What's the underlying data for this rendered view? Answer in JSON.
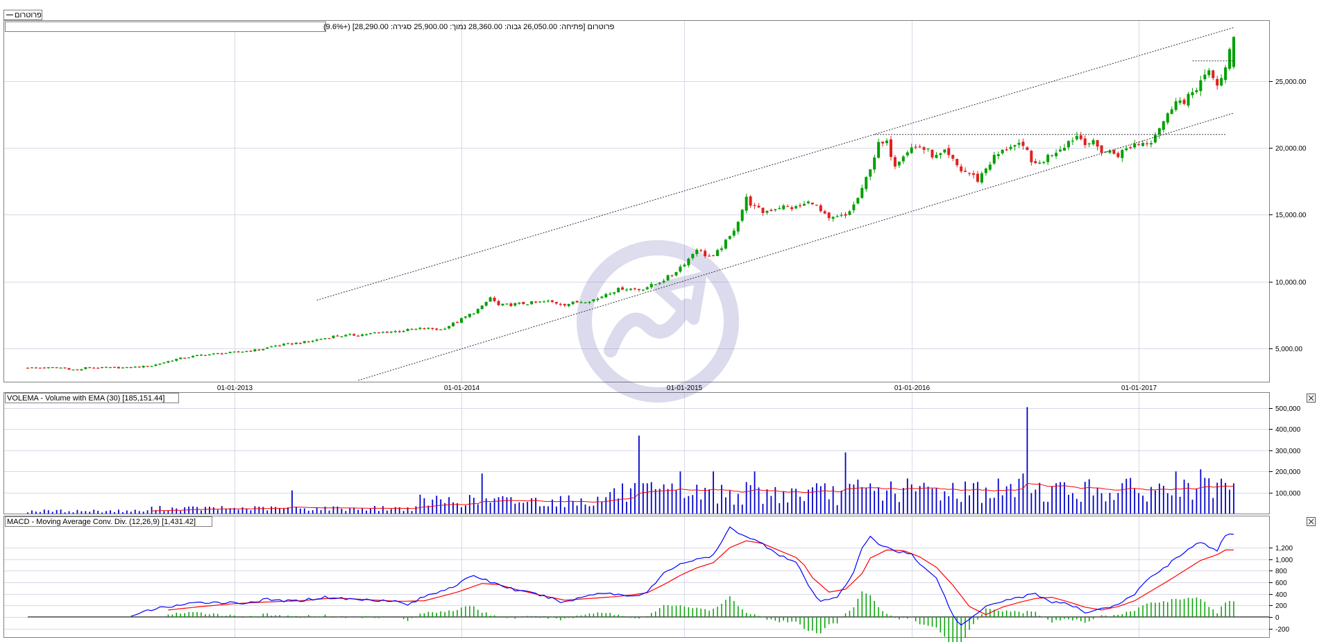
{
  "legend_tag": "פרוטרום",
  "colors": {
    "up": "#00a000",
    "down": "#e02020",
    "volume": "#0000cc",
    "ema": "#ff0000",
    "macd": "#0000ff",
    "signal": "#ff0000",
    "hist": "#00a000",
    "grid": "#d8d8e8",
    "frame": "#7f7f7f"
  },
  "chart_data": [
    {
      "type": "candlestick",
      "info_line": "פרוטרום [פתיחה: 26,050.00  גבוה: 28,360.00  נמוך: 25,900.00  סגירה: 28,290.00] (+9.6%)",
      "ylim": [
        2500,
        29500
      ],
      "yticks": [
        5000,
        10000,
        15000,
        20000,
        25000
      ],
      "ytick_labels": [
        "5,000.00",
        "10,000.00",
        "15,000.00",
        "20,000.00",
        "25,000.00"
      ],
      "xticks": [
        "01-01-2013",
        "01-01-2014",
        "01-01-2015",
        "01-01-2016",
        "01-01-2017"
      ],
      "anchors": [
        [
          0,
          3550
        ],
        [
          8,
          3550
        ],
        [
          12,
          3350
        ],
        [
          14,
          3550
        ],
        [
          24,
          3550
        ],
        [
          30,
          3700
        ],
        [
          36,
          4200
        ],
        [
          42,
          4500
        ],
        [
          50,
          4700
        ],
        [
          56,
          4900
        ],
        [
          60,
          5200
        ],
        [
          68,
          5500
        ],
        [
          74,
          5900
        ],
        [
          80,
          6000
        ],
        [
          86,
          6200
        ],
        [
          90,
          6300
        ],
        [
          96,
          6500
        ],
        [
          100,
          6400
        ],
        [
          104,
          7000
        ],
        [
          108,
          7700
        ],
        [
          110,
          8100
        ],
        [
          112,
          8800
        ],
        [
          114,
          8200
        ],
        [
          118,
          8300
        ],
        [
          122,
          8400
        ],
        [
          126,
          8500
        ],
        [
          130,
          8300
        ],
        [
          134,
          8500
        ],
        [
          138,
          8700
        ],
        [
          140,
          9100
        ],
        [
          144,
          9500
        ],
        [
          148,
          9400
        ],
        [
          152,
          9800
        ],
        [
          156,
          10500
        ],
        [
          160,
          11700
        ],
        [
          162,
          12500
        ],
        [
          164,
          12000
        ],
        [
          166,
          11800
        ],
        [
          168,
          12600
        ],
        [
          170,
          13300
        ],
        [
          172,
          14600
        ],
        [
          174,
          16200
        ],
        [
          176,
          15500
        ],
        [
          178,
          15200
        ],
        [
          182,
          15600
        ],
        [
          186,
          15500
        ],
        [
          190,
          16000
        ],
        [
          192,
          15200
        ],
        [
          194,
          14600
        ],
        [
          196,
          14800
        ],
        [
          198,
          14900
        ],
        [
          200,
          15700
        ],
        [
          202,
          16800
        ],
        [
          204,
          18600
        ],
        [
          206,
          20200
        ],
        [
          208,
          20300
        ],
        [
          210,
          18800
        ],
        [
          212,
          19600
        ],
        [
          214,
          20000
        ],
        [
          216,
          20100
        ],
        [
          218,
          19700
        ],
        [
          220,
          19300
        ],
        [
          222,
          19600
        ],
        [
          224,
          19000
        ],
        [
          226,
          18300
        ],
        [
          228,
          18100
        ],
        [
          230,
          17600
        ],
        [
          232,
          18500
        ],
        [
          234,
          19300
        ],
        [
          236,
          19700
        ],
        [
          238,
          20200
        ],
        [
          240,
          20100
        ],
        [
          242,
          19700
        ],
        [
          244,
          18600
        ],
        [
          246,
          19100
        ],
        [
          248,
          19600
        ],
        [
          250,
          20000
        ],
        [
          252,
          20500
        ],
        [
          254,
          20900
        ],
        [
          256,
          20500
        ],
        [
          258,
          20300
        ],
        [
          260,
          19800
        ],
        [
          262,
          19700
        ],
        [
          264,
          19500
        ],
        [
          266,
          19900
        ],
        [
          268,
          20300
        ],
        [
          270,
          20400
        ],
        [
          272,
          20600
        ],
        [
          274,
          21600
        ],
        [
          276,
          22400
        ],
        [
          278,
          23800
        ],
        [
          280,
          23200
        ],
        [
          282,
          24200
        ],
        [
          284,
          25000
        ],
        [
          286,
          25500
        ],
        [
          288,
          24800
        ],
        [
          290,
          25900
        ],
        [
          292,
          28290
        ]
      ],
      "upper_channel": [
        [
          70,
          8600
        ],
        [
          292,
          29000
        ]
      ],
      "lower_channel": [
        [
          80,
          2600
        ],
        [
          292,
          22600
        ]
      ],
      "resistance_main": [
        [
          205,
          21000
        ],
        [
          290,
          21000
        ]
      ],
      "resistance_short": [
        [
          282,
          26500
        ],
        [
          292,
          26500
        ]
      ]
    },
    {
      "type": "bar",
      "title": "VOLEMA - Volume with EMA (30) [185,151.44]",
      "ylim": [
        0,
        520000
      ],
      "yticks": [
        100000,
        200000,
        300000,
        400000,
        500000
      ],
      "ytick_labels": [
        "100,000",
        "200,000",
        "300,000",
        "400,000",
        "500,000"
      ],
      "spikes": [
        [
          64,
          110000
        ],
        [
          110,
          190000
        ],
        [
          148,
          370000
        ],
        [
          158,
          200000
        ],
        [
          166,
          200000
        ],
        [
          176,
          200000
        ],
        [
          198,
          290000
        ],
        [
          242,
          505000
        ],
        [
          241,
          190000
        ],
        [
          278,
          200000
        ],
        [
          284,
          210000
        ]
      ]
    },
    {
      "type": "line",
      "title": "MACD - Moving Average Conv. Div. (12,26,9) [1,431.42]",
      "ylim": [
        -350,
        1550
      ],
      "yticks": [
        -200,
        0,
        200,
        400,
        600,
        800,
        1000,
        1200
      ],
      "ytick_labels": [
        "-200",
        "0",
        "200",
        "400",
        "600",
        "800",
        "1,000",
        "1,200"
      ],
      "macd_anchors": [
        [
          25,
          0
        ],
        [
          30,
          130
        ],
        [
          36,
          200
        ],
        [
          44,
          260
        ],
        [
          52,
          240
        ],
        [
          58,
          300
        ],
        [
          64,
          270
        ],
        [
          72,
          340
        ],
        [
          80,
          300
        ],
        [
          88,
          290
        ],
        [
          92,
          210
        ],
        [
          96,
          350
        ],
        [
          104,
          560
        ],
        [
          108,
          720
        ],
        [
          112,
          610
        ],
        [
          118,
          470
        ],
        [
          124,
          380
        ],
        [
          130,
          250
        ],
        [
          134,
          340
        ],
        [
          138,
          420
        ],
        [
          142,
          400
        ],
        [
          146,
          360
        ],
        [
          150,
          430
        ],
        [
          154,
          750
        ],
        [
          158,
          930
        ],
        [
          162,
          990
        ],
        [
          166,
          1060
        ],
        [
          168,
          1300
        ],
        [
          170,
          1540
        ],
        [
          174,
          1400
        ],
        [
          178,
          1260
        ],
        [
          182,
          1080
        ],
        [
          186,
          940
        ],
        [
          188,
          690
        ],
        [
          190,
          420
        ],
        [
          192,
          260
        ],
        [
          196,
          360
        ],
        [
          200,
          760
        ],
        [
          202,
          1200
        ],
        [
          204,
          1380
        ],
        [
          206,
          1270
        ],
        [
          210,
          1150
        ],
        [
          214,
          1090
        ],
        [
          216,
          900
        ],
        [
          220,
          700
        ],
        [
          222,
          350
        ],
        [
          224,
          30
        ],
        [
          226,
          -150
        ],
        [
          228,
          -40
        ],
        [
          232,
          200
        ],
        [
          236,
          280
        ],
        [
          240,
          340
        ],
        [
          244,
          400
        ],
        [
          248,
          260
        ],
        [
          252,
          220
        ],
        [
          256,
          80
        ],
        [
          260,
          150
        ],
        [
          264,
          200
        ],
        [
          268,
          400
        ],
        [
          272,
          700
        ],
        [
          276,
          900
        ],
        [
          280,
          1130
        ],
        [
          284,
          1300
        ],
        [
          286,
          1210
        ],
        [
          288,
          1130
        ],
        [
          290,
          1431
        ]
      ],
      "signal_anchors": [
        [
          34,
          120
        ],
        [
          42,
          180
        ],
        [
          50,
          230
        ],
        [
          58,
          260
        ],
        [
          66,
          280
        ],
        [
          74,
          330
        ],
        [
          82,
          300
        ],
        [
          90,
          270
        ],
        [
          96,
          280
        ],
        [
          104,
          430
        ],
        [
          110,
          580
        ],
        [
          114,
          560
        ],
        [
          118,
          480
        ],
        [
          124,
          380
        ],
        [
          130,
          290
        ],
        [
          136,
          320
        ],
        [
          142,
          350
        ],
        [
          146,
          380
        ],
        [
          150,
          420
        ],
        [
          154,
          560
        ],
        [
          158,
          720
        ],
        [
          162,
          850
        ],
        [
          166,
          940
        ],
        [
          170,
          1200
        ],
        [
          174,
          1320
        ],
        [
          178,
          1270
        ],
        [
          182,
          1150
        ],
        [
          186,
          1030
        ],
        [
          188,
          900
        ],
        [
          190,
          680
        ],
        [
          194,
          430
        ],
        [
          198,
          480
        ],
        [
          202,
          750
        ],
        [
          204,
          1020
        ],
        [
          208,
          1160
        ],
        [
          212,
          1150
        ],
        [
          216,
          1040
        ],
        [
          220,
          860
        ],
        [
          224,
          550
        ],
        [
          228,
          180
        ],
        [
          232,
          40
        ],
        [
          236,
          170
        ],
        [
          240,
          250
        ],
        [
          244,
          320
        ],
        [
          248,
          340
        ],
        [
          252,
          260
        ],
        [
          256,
          170
        ],
        [
          260,
          120
        ],
        [
          264,
          180
        ],
        [
          268,
          280
        ],
        [
          272,
          450
        ],
        [
          276,
          620
        ],
        [
          280,
          800
        ],
        [
          284,
          980
        ],
        [
          288,
          1080
        ],
        [
          290,
          1160
        ]
      ]
    }
  ]
}
